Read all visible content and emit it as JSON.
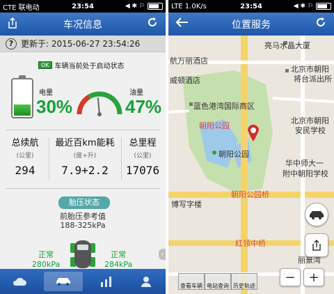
{
  "left": {
    "status": {
      "carrier": "CTE 联电动",
      "time": "23:54",
      "icons": "◀ ✱ ⚐"
    },
    "nav": {
      "title": "车况信息"
    },
    "updated": "更新于: 2015-06-27 23:54:26",
    "vehicle_state": {
      "badge": "OK",
      "text": "车辆当前处于启动状态"
    },
    "battery": {
      "label": "电量",
      "value": "30%",
      "level": 0.3
    },
    "fuel": {
      "label": "油量",
      "value": "47%",
      "level": 0.47
    },
    "stats": [
      {
        "title": "总续航",
        "unit": "(公里)",
        "value": "294"
      },
      {
        "title": "最近百km能耗",
        "unit": "(度+升)",
        "value": "7.9+2.2"
      },
      {
        "title": "总里程",
        "unit": "(公里)",
        "value": "17076"
      }
    ],
    "tire": {
      "button": "胎压状态",
      "ref_label": "前胎压参考值",
      "ref_value": "188-325kPa",
      "left_status": "正常",
      "left_value": "280kPa",
      "right_status": "正常",
      "right_value": "284kPa"
    },
    "tabs": [
      "weather",
      "car",
      "stats",
      "profile"
    ]
  },
  "right": {
    "status": {
      "carrier": "LTE 1.0K/s",
      "time": "23:54",
      "icons": "◀ ✱ ⚐"
    },
    "nav": {
      "title": "位置服务"
    },
    "labels": {
      "a": "亮马水晶大厦",
      "b": "航万丽酒店",
      "c": "北京市朝阳",
      "d": "将台派出所",
      "e": "威顿酒店",
      "f": "蓝色港湾国际商区",
      "g": "朝阳公园",
      "h": "北京市朝阳",
      "i": "安民学校",
      "j": "朝阳公园",
      "k": "华中师大一",
      "l": "附中朝阳学校",
      "m": "朝阳公园桥",
      "n": "博写字楼",
      "o": "红领中桥",
      "p": "丽景湾"
    },
    "tools": [
      "查看车辆",
      "电站查询",
      "历史轨迹"
    ]
  }
}
